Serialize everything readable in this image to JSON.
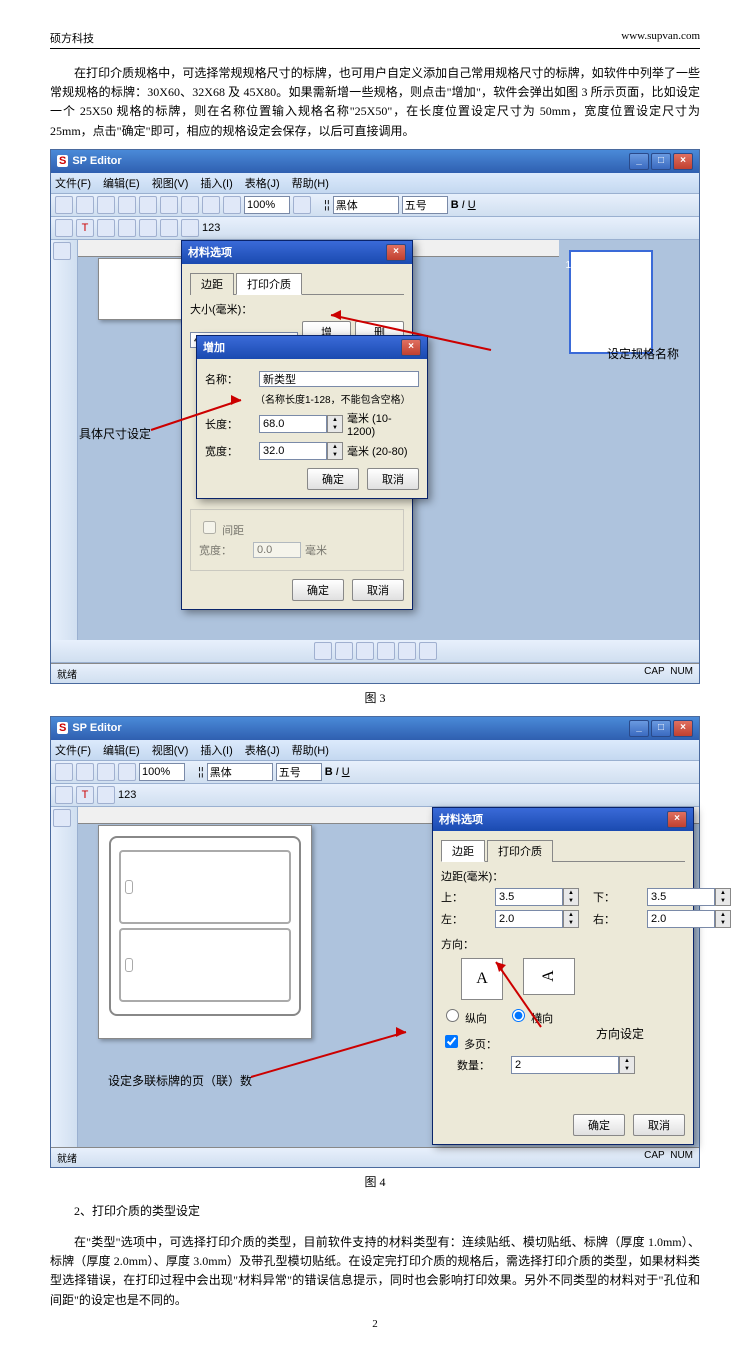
{
  "header": {
    "company": "硕方科技",
    "url": "www.supvan.com"
  },
  "para1": "在打印介质规格中，可选择常规规格尺寸的标牌，也可用户自定义添加自己常用规格尺寸的标牌，如软件中列举了一些常规规格的标牌：30X60、32X68 及 45X80。如果需新增一些规格，则点击\"增加\"，软件会弹出如图 3 所示页面，比如设定一个 25X50 规格的标牌，则在名称位置输入规格名称\"25X50\"，在长度位置设定尺寸为 50mm，宽度位置设定尺寸为 25mm，点击\"确定\"即可，相应的规格设定会保存，以后可直接调用。",
  "app_title": "SP Editor",
  "menu": [
    "文件(F)",
    "编辑(E)",
    "视图(V)",
    "插入(I)",
    "表格(J)",
    "帮助(H)"
  ],
  "zoom": "100%",
  "font": "黑体",
  "fontsize": "五号",
  "bold": "B",
  "italic": "I",
  "underline": "U",
  "fig3": {
    "dialog1_title": "材料选项",
    "tab_margin": "边距",
    "tab_media": "打印介质",
    "size_label": "大小(毫米)：",
    "size_value": "45X80",
    "btn_add": "增加",
    "btn_del": "删除",
    "dialog2_title": "增加",
    "name_label": "名称：",
    "name_value": "新类型",
    "name_hint": "（名称长度1-128，不能包含空格）",
    "length_label": "长度：",
    "length_value": "68.0",
    "length_unit": "毫米  (10-1200)",
    "width_label": "宽度：",
    "width_value": "32.0",
    "width_unit": "毫米  (20-80)",
    "btn_ok": "确定",
    "btn_cancel": "取消",
    "gap_group": "间距",
    "gap_width": "宽度：",
    "gap_value": "0.0",
    "gap_unit": "毫米",
    "anno_spec": "设定规格名称",
    "anno_size": "具体尺寸设定",
    "caption": "图 3"
  },
  "fig4": {
    "dialog_title": "材料选项",
    "tab_margin": "边距",
    "tab_media": "打印介质",
    "margin_label": "边距(毫米)：",
    "top": "上：",
    "top_v": "3.5",
    "bottom": "下：",
    "bottom_v": "3.5",
    "left": "左：",
    "left_v": "2.0",
    "right": "右：",
    "right_v": "2.0",
    "orient_label": "方向：",
    "portrait": "纵向",
    "landscape": "横向",
    "multi": "多页：",
    "qty": "数量：",
    "qty_v": "2",
    "btn_ok": "确定",
    "btn_cancel": "取消",
    "anno_orient": "方向设定",
    "anno_multi": "设定多联标牌的页（联）数",
    "caption": "图 4"
  },
  "status": {
    "ready": "就绪",
    "cap": "CAP",
    "num": "NUM"
  },
  "section2": "2、打印介质的类型设定",
  "para2": "在\"类型\"选项中，可选择打印介质的类型，目前软件支持的材料类型有：连续贴纸、模切贴纸、标牌（厚度 1.0mm）、标牌（厚度 2.0mm）、厚度 3.0mm）及带孔型模切贴纸。在设定完打印介质的规格后，需选择打印介质的类型，如果材料类型选择错误，在打印过程中会出现\"材料异常\"的错误信息提示，同时也会影响打印效果。另外不同类型的材料对于\"孔位和间距\"的设定也是不同的。",
  "page_num": "2"
}
